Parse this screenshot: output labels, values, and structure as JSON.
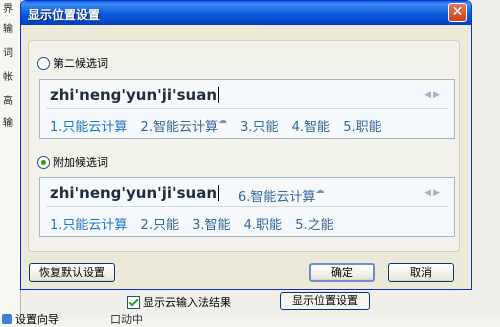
{
  "background": {
    "side_tabs": [
      "界",
      "输",
      "词",
      "帐",
      "高",
      "输"
    ],
    "check_label": "显示云输入法结果",
    "display_button": "显示位置设置",
    "settings_label": "设置向导",
    "extra_label": "口动中"
  },
  "dialog": {
    "title": "显示位置设置",
    "close_glyph": "✕",
    "option_second": "第二候选词",
    "option_attach": "附加候选词",
    "selected_option": "附加候选词",
    "preview1": {
      "pinyin": "zhi'neng'yun'ji'suan",
      "arrows": "◀▶",
      "candidates": [
        "1.只能云计算",
        "2.智能云计算",
        "3.只能",
        "4.智能",
        "5.职能"
      ],
      "cloud_after_index": 1
    },
    "preview2": {
      "pinyin": "zhi'neng'yun'ji'suan",
      "extra": "6.智能云计算",
      "arrows": "◀▶",
      "candidates": [
        "1.只能云计算",
        "2.只能",
        "3.智能",
        "4.职能",
        "5.之能"
      ]
    },
    "buttons": {
      "restore": "恢复默认设置",
      "ok": "确定",
      "cancel": "取消"
    }
  }
}
